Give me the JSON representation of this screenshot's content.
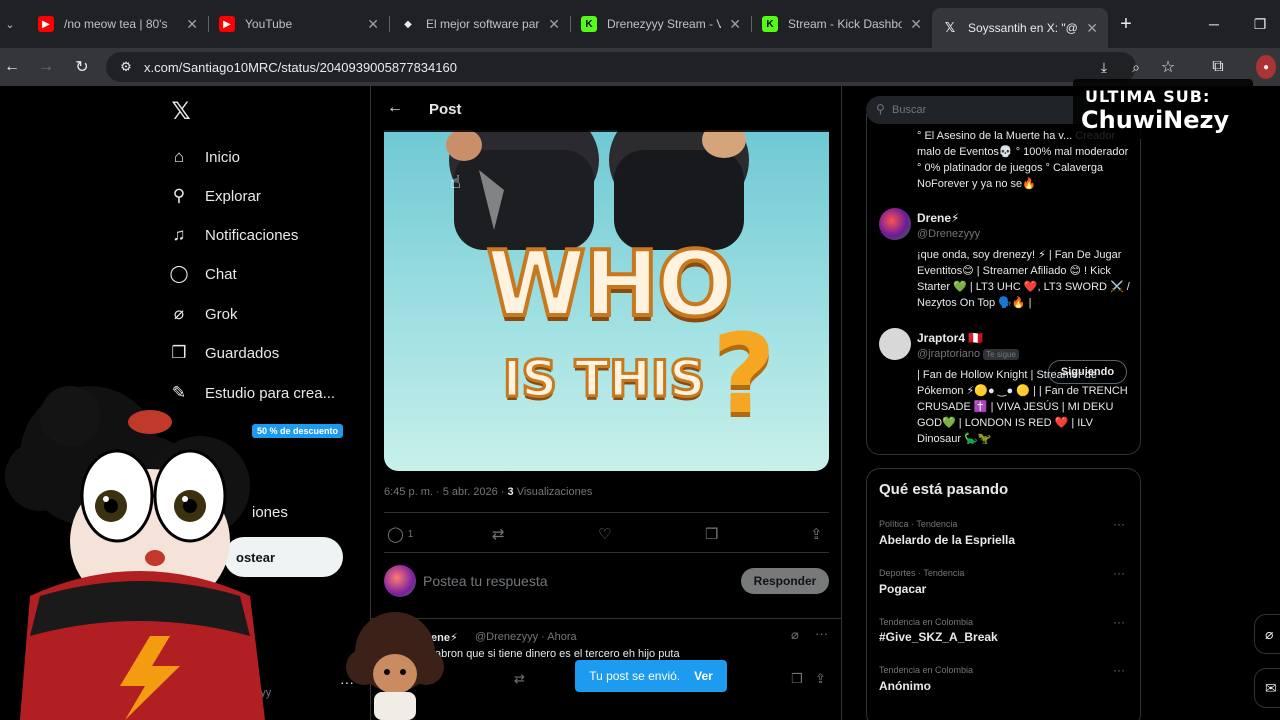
{
  "browser": {
    "tabs": [
      {
        "title": "/no meow tea | 80's",
        "favicon": "youtube-icon",
        "color": "#ff0000"
      },
      {
        "title": "YouTube",
        "favicon": "youtube-icon",
        "color": "#ff0000"
      },
      {
        "title": "El mejor software par",
        "favicon": "shield-icon",
        "color": "#e8eaed"
      },
      {
        "title": "Drenezyyy Stream - V",
        "favicon": "kick-icon",
        "color": "#53fc18"
      },
      {
        "title": "Stream - Kick Dashbo",
        "favicon": "kick-icon",
        "color": "#53fc18"
      },
      {
        "title": "Soyssantih en X: \"@D",
        "favicon": "x-icon",
        "color": "#e8eaed"
      }
    ],
    "url": "x.com/Santiago10MRC/status/2040939005877834160"
  },
  "nav": {
    "items": [
      {
        "label": "Inicio",
        "icon": "home-icon"
      },
      {
        "label": "Explorar",
        "icon": "search-icon"
      },
      {
        "label": "Notificaciones",
        "icon": "bell-icon"
      },
      {
        "label": "Chat",
        "icon": "chat-icon"
      },
      {
        "label": "Grok",
        "icon": "grok-icon"
      },
      {
        "label": "Guardados",
        "icon": "bookmark-icon"
      },
      {
        "label": "Estudio para crea...",
        "icon": "studio-icon"
      }
    ],
    "promo_badge": "50 % de descuento",
    "partial_label": "iones",
    "post_button": "ostear",
    "profile_name": "e⚡",
    "profile_handle": "nezyyy"
  },
  "post": {
    "header_title": "Post",
    "media_text_1": "WHO",
    "media_text_2": "IS THIS",
    "media_text_3": "?",
    "time": "6:45 p. m. · 5 abr. 2026 ·",
    "views_count": "3",
    "views_label": "Visualizaciones",
    "reply_count": "1",
    "reply_placeholder": "Postea tu respuesta",
    "reply_button": "Responder"
  },
  "reply_tweet": {
    "name": "ene⚡",
    "handle": "@Drenezyyy · Ahora",
    "text": "abron que si tiene dinero es el tercero eh hijo puta"
  },
  "toast": {
    "message": "Tu post se envió.",
    "action": "Ver"
  },
  "sidebar": {
    "search_placeholder": "Buscar",
    "first_bio": "° El Asesino de la Muerte ha v... Creador malo de Eventos💀 ° 100% mal moderador ° 0% platinador de juegos ° Calaverga NoForever y ya no se🔥",
    "accounts": [
      {
        "name": "Drene⚡",
        "handle": "@Drenezyyy",
        "bio": "¡que onda, soy drenezy! ⚡ | Fan De Jugar Eventitos😊 | Streamer Afiliado 😊 ! Kick Starter 💚 | LT3 UHC ❤️, LT3 SWORD ⚔️ / Nezytos On Top 🗣️🔥 |"
      },
      {
        "name": "Jraptor4 🇵🇪",
        "handle": "@jraptoriano",
        "badge": "Te sigue",
        "button": "Siguiendo",
        "bio": "| Fan de Hollow Knight | Streamer de Pókemon ⚡🟡● ‿● 🟡 | | Fan de TRENCH CRUSADE ✝️ | VIVA JESÚS | MI DEKU GOD💚 | LONDON IS RED ❤️ | ILV Dinosaur 🦕🦖"
      }
    ]
  },
  "trends": {
    "title": "Qué está pasando",
    "items": [
      {
        "meta": "Política · Tendencia",
        "name": "Abelardo de la Espriella"
      },
      {
        "meta": "Deportes · Tendencia",
        "name": "Pogacar"
      },
      {
        "meta": "Tendencia en Colombia",
        "name": "#Give_SKZ_A_Break"
      },
      {
        "meta": "Tendencia en Colombia",
        "name": "Anónimo"
      }
    ]
  },
  "overlay": {
    "label": "ULTIMA SUB:",
    "name": "ChuwiNezy"
  }
}
